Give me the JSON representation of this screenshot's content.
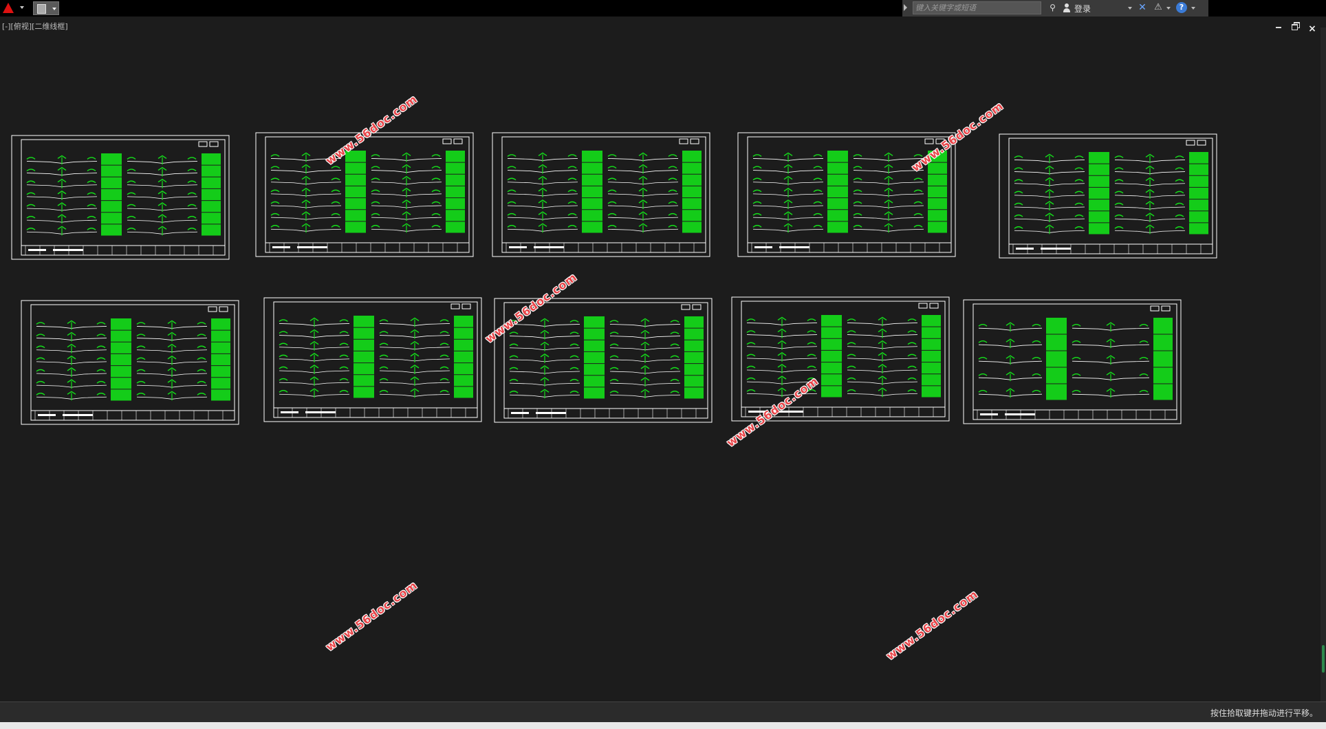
{
  "topbar": {
    "search_placeholder": "键入关键字或短语",
    "login_label": "登录"
  },
  "viewport": {
    "label": "[-][俯视][二维线框]"
  },
  "watermarks": [
    "www.56doc.com",
    "www.56doc.com",
    "www.56doc.com",
    "www.56doc.com",
    "www.56doc.com",
    "www.56doc.com"
  ],
  "status": {
    "message": "按住拾取键并拖动进行平移。"
  },
  "colors": {
    "background": "#1c1c1c",
    "drawing_green": "#14e01a",
    "watermark_red": "#e8464a",
    "frame_white": "#ffffff"
  },
  "icons": {
    "app": "autocad-logo-icon",
    "qat": "document-icon",
    "search_binoculars": "binoculars-icon",
    "user": "user-icon",
    "exchange": "exchange-icon",
    "a360": "a360-icon",
    "help": "help-icon"
  }
}
